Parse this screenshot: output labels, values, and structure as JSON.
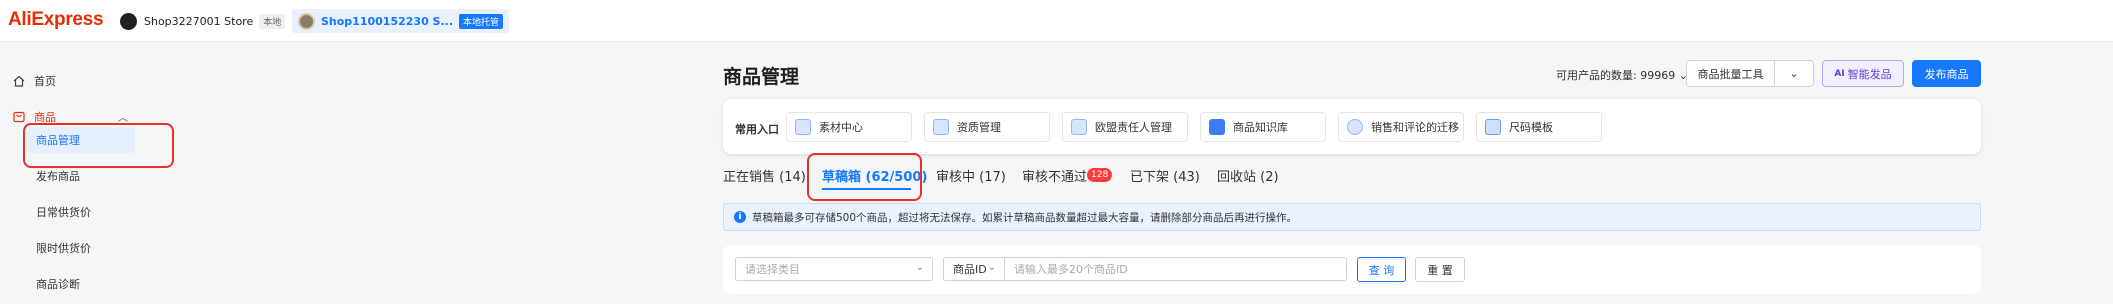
{
  "app": {
    "logo": "AliExpress"
  },
  "header": {
    "store1": {
      "name": "Shop3227001 Store",
      "tag": "本地"
    },
    "store2": {
      "name": "Shop1100152230 S...",
      "tag": "本地托管"
    }
  },
  "sidebar": {
    "home": "首页",
    "products": "商品",
    "sub": [
      "商品管理",
      "发布商品",
      "日常供货价",
      "限时供货价",
      "商品诊断"
    ]
  },
  "main": {
    "title": "商品管理",
    "available_label": "可用产品的数量: 99969",
    "bulk_tools": "商品批量工具",
    "ai_button": "智能发品",
    "ai_prefix": "AI",
    "publish_button": "发布商品",
    "quick_entry_label": "常用入口",
    "quick_items": [
      "素材中心",
      "资质管理",
      "欧盟责任人管理",
      "商品知识库",
      "销售和评论的迁移",
      "尺码模板"
    ],
    "tabs": [
      "正在销售 (14)",
      "草稿箱 (62/500)",
      "审核中 (17)",
      "审核不通过",
      "已下架 (43)",
      "回收站 (2)"
    ],
    "reject_badge": "128",
    "info_text": "草稿箱最多可存储500个商品，超过将无法保存。如累计草稿商品数量超过最大容量，请删除部分商品后再进行操作。",
    "category_placeholder": "请选择类目",
    "id_select": "商品ID",
    "id_placeholder": "请输入最多20个商品ID",
    "query_button": "查 询",
    "reset_button": "重 置"
  },
  "colors": {
    "accent": "#1677ff",
    "brand": "#e62e04",
    "highlight": "#e8302a",
    "badge": "#ff3b3b"
  }
}
